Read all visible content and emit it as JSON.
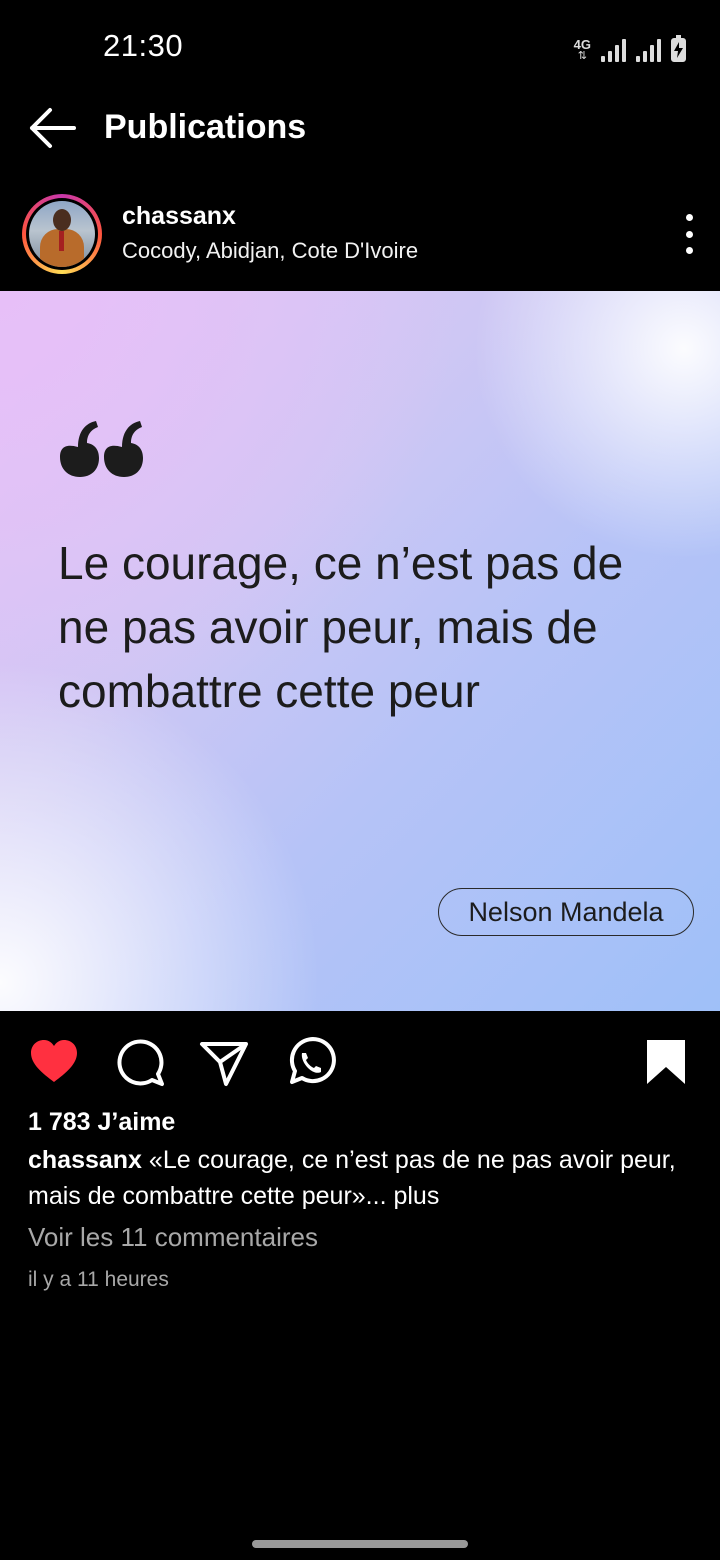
{
  "status_bar": {
    "time": "21:30",
    "network": "4G"
  },
  "header": {
    "title": "Publications"
  },
  "post": {
    "username": "chassanx",
    "location": "Cocody, Abidjan, Cote D'Ivoire",
    "quote": "Le courage, ce n’est pas de ne pas avoir peur, mais de combattre cette peur",
    "author": "Nelson Mandela",
    "likes": "1 783 J’aime",
    "caption_user": "chassanx",
    "caption_text": "«Le courage, ce n’est pas de ne pas avoir peur, mais de combattre cette peur»...",
    "caption_more": "plus",
    "comments_link": "Voir les 11 commentaires",
    "timestamp": "il y a 11 heures"
  },
  "colors": {
    "like": "#ff3040",
    "background": "#000000"
  },
  "icons": [
    "back-arrow-icon",
    "more-vertical-icon",
    "heart-icon",
    "comment-icon",
    "share-icon",
    "whatsapp-icon",
    "bookmark-icon"
  ]
}
